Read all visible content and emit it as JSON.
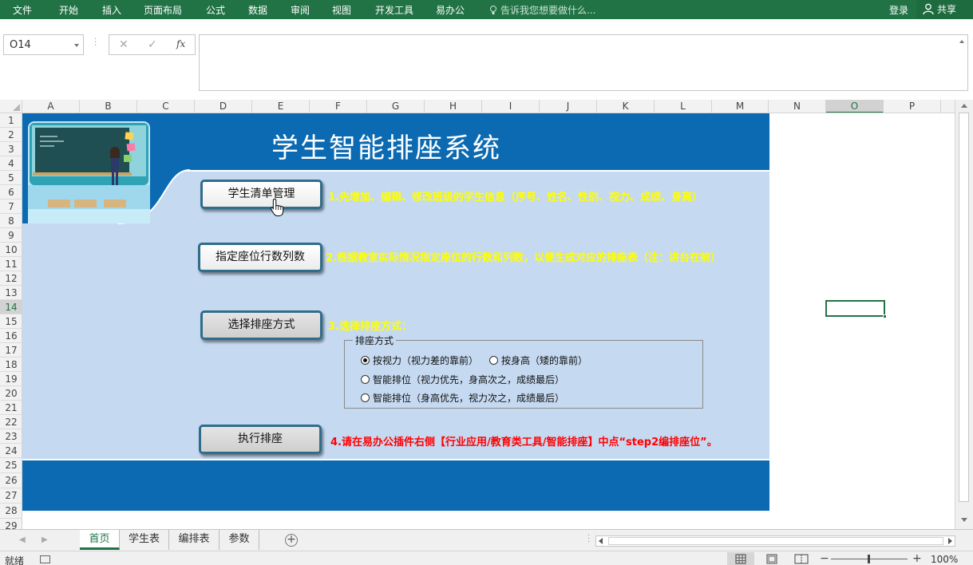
{
  "ribbon": {
    "tabs": [
      "文件",
      "开始",
      "插入",
      "页面布局",
      "公式",
      "数据",
      "审阅",
      "视图",
      "开发工具",
      "易办公"
    ],
    "tell_me": "告诉我您想要做什么...",
    "login": "登录",
    "share": "共享"
  },
  "formula_bar": {
    "name_box": "O14",
    "fx": "fx",
    "formula": ""
  },
  "columns": [
    "A",
    "B",
    "C",
    "D",
    "E",
    "F",
    "G",
    "H",
    "I",
    "J",
    "K",
    "L",
    "M",
    "N",
    "O",
    "P"
  ],
  "rows": [
    "1",
    "2",
    "3",
    "4",
    "5",
    "6",
    "7",
    "8",
    "9",
    "10",
    "11",
    "12",
    "13",
    "14",
    "15",
    "16",
    "17",
    "18",
    "19",
    "20",
    "21",
    "22",
    "23",
    "24",
    "25",
    "26",
    "27",
    "28",
    "29"
  ],
  "selected_column": "O",
  "selected_row": "14",
  "dashboard": {
    "title": "学生智能排座系统",
    "colors": {
      "banner_dark": "#0b6ab2",
      "banner_light": "#c5d9f1",
      "note_yellow": "#ffff00",
      "note_red": "#ff0000"
    },
    "buttons": {
      "student_list": "学生清单管理",
      "seat_grid": "指定座位行数列数",
      "choose_method": "选择排座方式",
      "run": "执行排座"
    },
    "notes": {
      "step1": "1.先增加、编辑、修改班级的学生信息（序号、姓名、性别、视力、成绩、身高）",
      "step2": "2.根据教室实际情况指定座位的行数和列数，以便生成对应的排座表（注：讲台在前）",
      "step3": "3.选择排座方式：",
      "step4": "4.请在易办公插件右侧【行业应用/教育类工具/智能排座】中点“step2编排座位”。"
    },
    "method_group": {
      "legend": "排座方式",
      "options": [
        {
          "label": "按视力（视力差的靠前）",
          "selected": true
        },
        {
          "label": "按身高（矮的靠前）",
          "selected": false
        },
        {
          "label": "智能排位（视力优先，身高次之，成绩最后）",
          "selected": false
        },
        {
          "label": "智能排位（身高优先，视力次之，成绩最后）",
          "selected": false
        }
      ]
    }
  },
  "sheet_tabs": [
    "首页",
    "学生表",
    "编排表",
    "参数"
  ],
  "active_sheet": "首页",
  "status": {
    "ready": "就绪",
    "zoom": "100%"
  }
}
